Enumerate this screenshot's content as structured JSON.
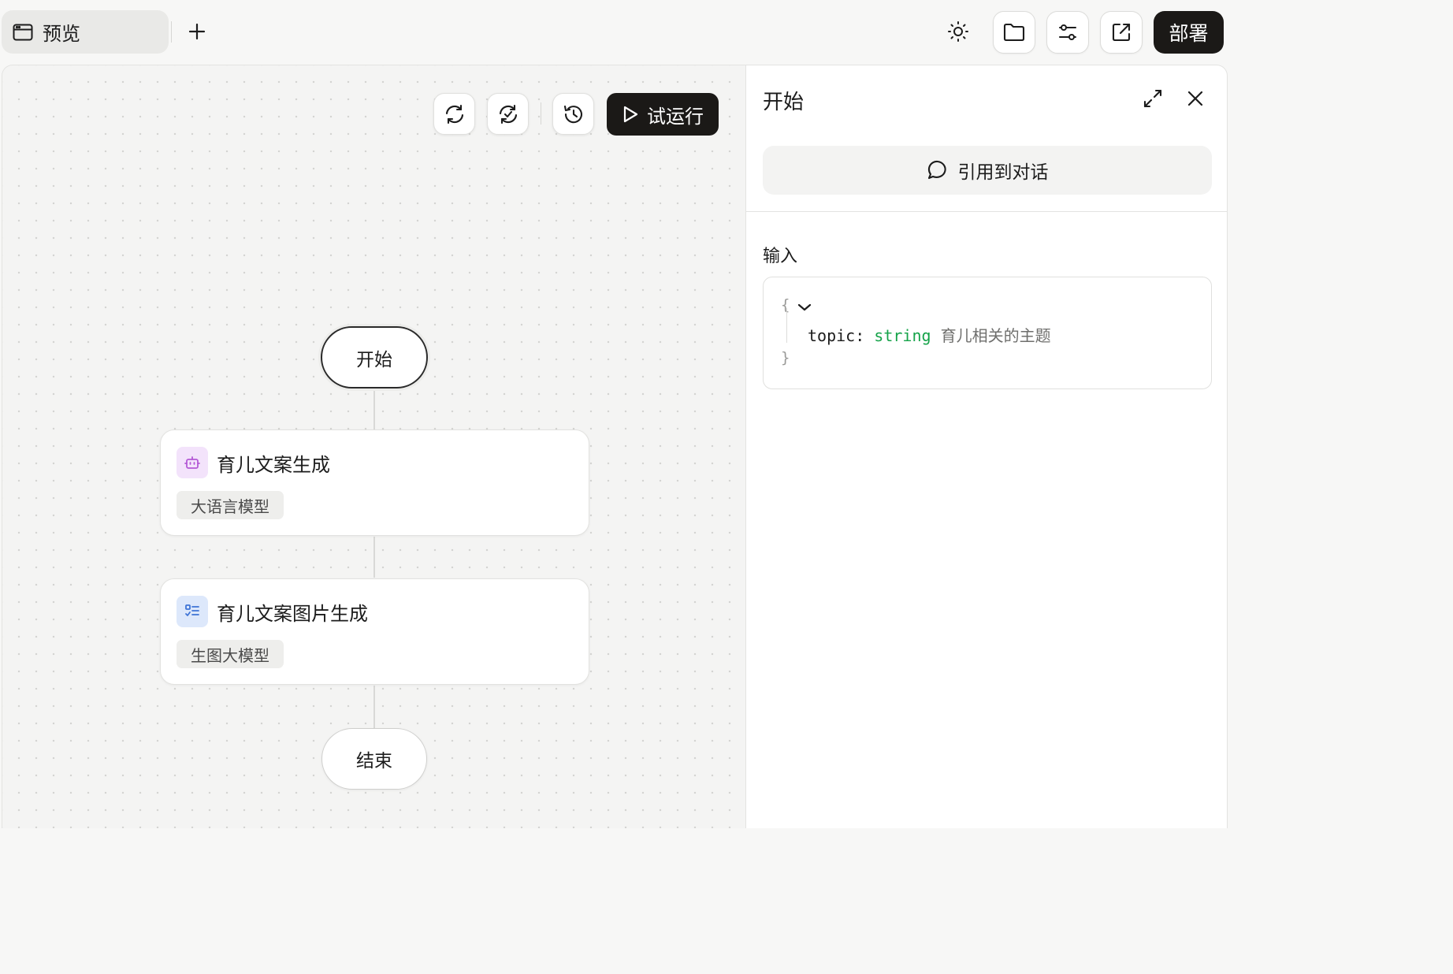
{
  "topbar": {
    "tab_label": "预览",
    "deploy_label": "部署",
    "icons": [
      "browser-window-icon",
      "plus-icon",
      "sun-icon",
      "folder-icon",
      "sliders-icon",
      "external-link-icon"
    ]
  },
  "canvas": {
    "run_label": "试运行",
    "toolbar_icons": [
      "refresh-icon",
      "sync-icon",
      "history-icon",
      "play-icon"
    ],
    "start_node": "开始",
    "end_node": "结束",
    "nodes": [
      {
        "title": "育儿文案生成",
        "badge": "大语言模型",
        "icon": "robot-icon",
        "icon_bg": "#f3e3fb",
        "icon_color": "#b45ad6"
      },
      {
        "title": "育儿文案图片生成",
        "badge": "生图大模型",
        "icon": "list-check-icon",
        "icon_bg": "#dde8fb",
        "icon_color": "#3f74d6"
      }
    ]
  },
  "panel": {
    "title": "开始",
    "quote_label": "引用到对话",
    "input_label": "输入",
    "schema": {
      "open_brace": "{",
      "close_brace": "}",
      "key": "topic:",
      "type": "string",
      "description": "育儿相关的主题"
    }
  },
  "colors": {
    "dark_button": "#1b1917",
    "string_type": "#16a34a"
  }
}
